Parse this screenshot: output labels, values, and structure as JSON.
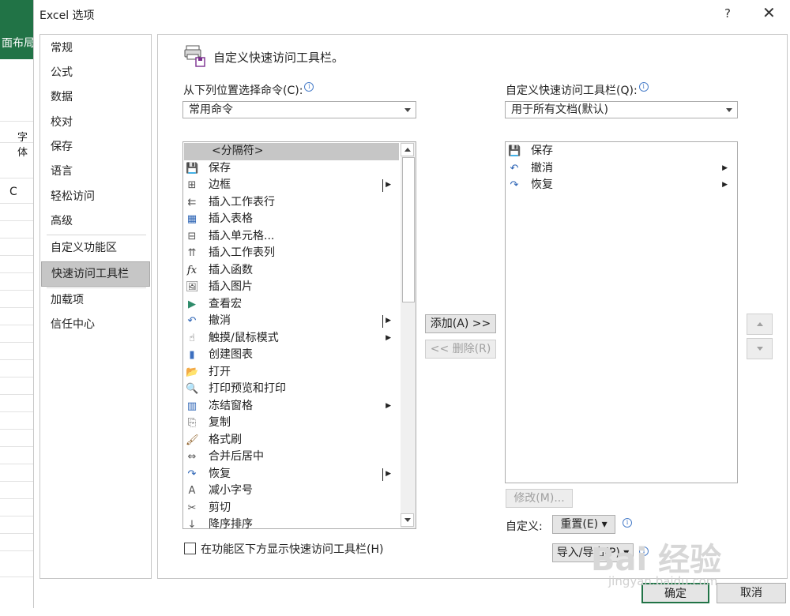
{
  "background": {
    "tab_label": "面布局",
    "cell_label": "C",
    "font_label": "字体"
  },
  "dialog": {
    "title": "Excel 选项",
    "help": "?",
    "close": "✕"
  },
  "nav": {
    "items": [
      {
        "label": "常规"
      },
      {
        "label": "公式"
      },
      {
        "label": "数据"
      },
      {
        "label": "校对"
      },
      {
        "label": "保存"
      },
      {
        "label": "语言"
      },
      {
        "label": "轻松访问"
      },
      {
        "label": "高级"
      },
      {
        "label": "自定义功能区"
      },
      {
        "label": "快速访问工具栏"
      },
      {
        "label": "加载项"
      },
      {
        "label": "信任中心"
      }
    ],
    "selected": "快速访问工具栏"
  },
  "main": {
    "heading": "自定义快速访问工具栏。",
    "choose_label": "从下列位置选择命令(C):",
    "choose_value": "常用命令",
    "target_label": "自定义快速访问工具栏(Q):",
    "target_value": "用于所有文档(默认)",
    "commands": [
      {
        "label": "<分隔符>",
        "icon": "separator-icon"
      },
      {
        "label": "保存",
        "icon": "save-icon",
        "glyph": "💾"
      },
      {
        "label": "边框",
        "icon": "borders-icon",
        "glyph": "⊞",
        "submenu": true,
        "bar": true
      },
      {
        "label": "插入工作表行",
        "icon": "insert-row-icon",
        "glyph": "⇇"
      },
      {
        "label": "插入表格",
        "icon": "insert-table-icon",
        "glyph": "▦"
      },
      {
        "label": "插入单元格...",
        "icon": "insert-cells-icon",
        "glyph": "⊟"
      },
      {
        "label": "插入工作表列",
        "icon": "insert-column-icon",
        "glyph": "⇈"
      },
      {
        "label": "插入函数",
        "icon": "function-icon",
        "glyph": "fx"
      },
      {
        "label": "插入图片",
        "icon": "picture-icon",
        "glyph": "🖼"
      },
      {
        "label": "查看宏",
        "icon": "macro-icon",
        "glyph": "▶"
      },
      {
        "label": "撤消",
        "icon": "undo-icon",
        "glyph": "↶",
        "submenu": true,
        "bar": true
      },
      {
        "label": "触摸/鼠标模式",
        "icon": "touch-mode-icon",
        "glyph": "☝",
        "submenu": true
      },
      {
        "label": "创建图表",
        "icon": "chart-icon",
        "glyph": "▮"
      },
      {
        "label": "打开",
        "icon": "open-icon",
        "glyph": "📂"
      },
      {
        "label": "打印预览和打印",
        "icon": "print-preview-icon",
        "glyph": "🔍"
      },
      {
        "label": "冻结窗格",
        "icon": "freeze-panes-icon",
        "glyph": "▥",
        "submenu": true
      },
      {
        "label": "复制",
        "icon": "copy-icon",
        "glyph": "⎘"
      },
      {
        "label": "格式刷",
        "icon": "format-painter-icon",
        "glyph": "🖌"
      },
      {
        "label": "合并后居中",
        "icon": "merge-center-icon",
        "glyph": "⇔"
      },
      {
        "label": "恢复",
        "icon": "redo-icon",
        "glyph": "↷",
        "submenu": true,
        "bar": true
      },
      {
        "label": "减小字号",
        "icon": "decrease-font-icon",
        "glyph": "A"
      },
      {
        "label": "剪切",
        "icon": "cut-icon",
        "glyph": "✂"
      },
      {
        "label": "降序排序",
        "icon": "sort-desc-icon",
        "glyph": "↓"
      }
    ],
    "qat_items": [
      {
        "label": "保存",
        "icon": "save-icon",
        "glyph": "💾"
      },
      {
        "label": "撤消",
        "icon": "undo-icon",
        "glyph": "↶",
        "submenu": true
      },
      {
        "label": "恢复",
        "icon": "redo-icon",
        "glyph": "↷",
        "submenu": true
      }
    ],
    "add_button": "添加(A) >>",
    "remove_button": "<< 删除(R)",
    "modify_button": "修改(M)...",
    "customize_label": "自定义:",
    "reset_button": "重置(E) ▾",
    "import_export_button": "导入/导出(P) ▾",
    "show_below_label": "在功能区下方显示快速访问工具栏(H)",
    "show_below_checked": false
  },
  "footer": {
    "ok": "确定",
    "cancel": "取消"
  },
  "watermark": {
    "text": "Bai 经验",
    "url": "jingyan.baidu.com"
  }
}
